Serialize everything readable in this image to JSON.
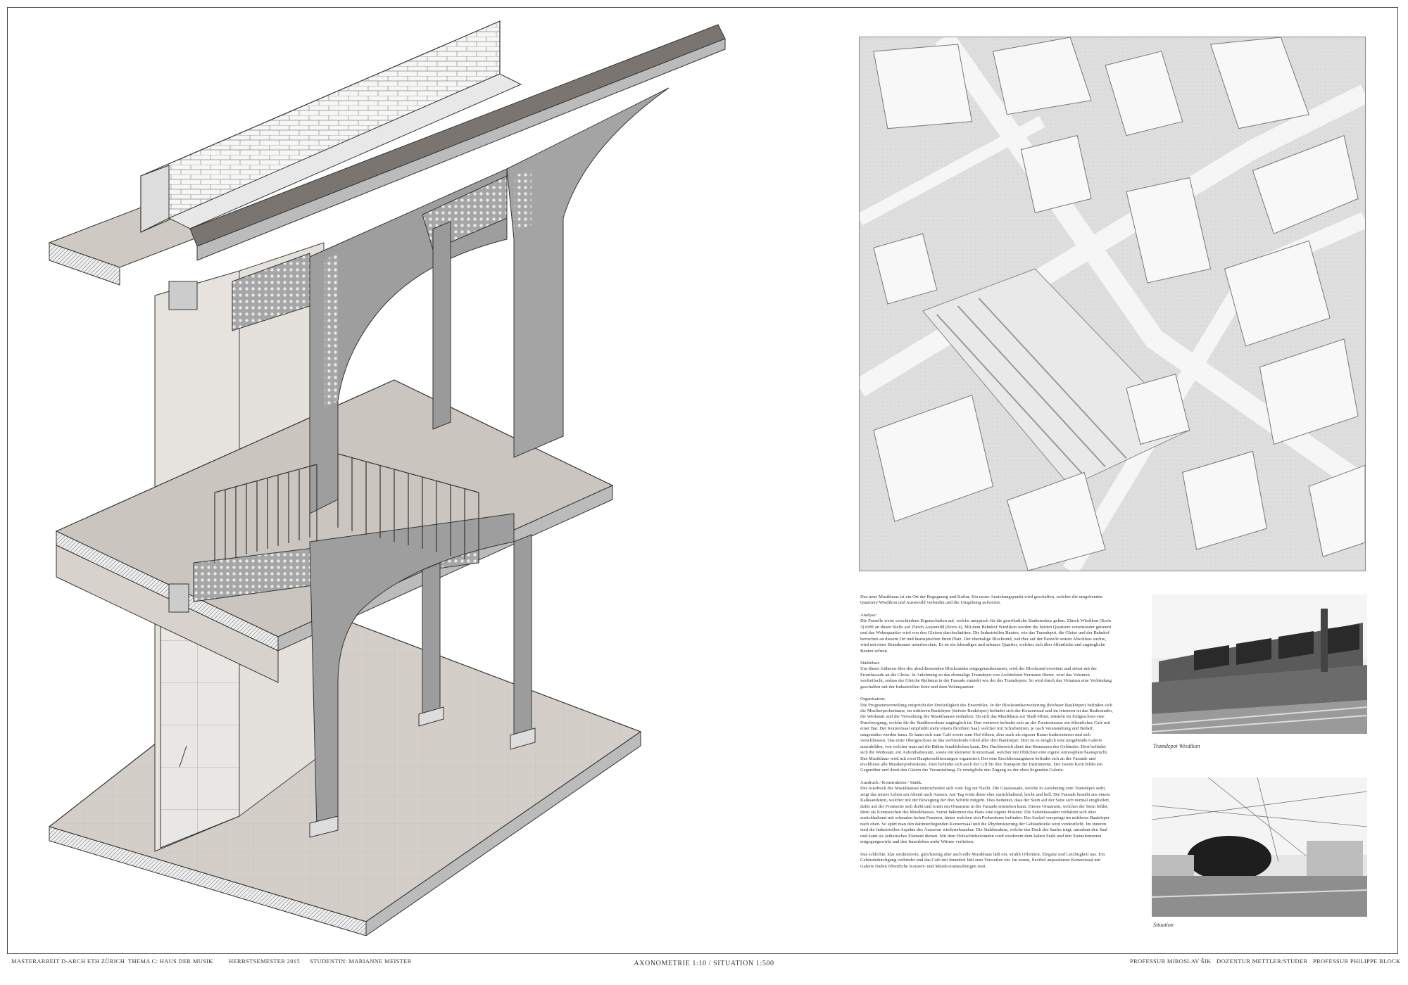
{
  "footer": {
    "left": [
      "MASTERARBEIT D-ARCH ETH ZÜRICH",
      "THEMA C: HAUS DER MUSIK",
      "HERBSTSEMESTER 2015",
      "STUDENTIN: MARIANNE MEISTER"
    ],
    "center": "AXONOMETRIE 1:10 / SITUATION 1:500",
    "right": [
      "PROFESSUR MIROSLAV ŠIK",
      "DOZENTUR METTLER/STUDER",
      "PROFESSUR PHILIPPE BLOCK"
    ]
  },
  "text": {
    "intro": "Das neue Musikhaus ist ein Ort der Begegnung und Kultur. Ein neuer Anziehungspunkt wird geschaffen, welcher die umgebenden Quartiere Wiedikon und Aussersihl verbindet und die Umgebung aufwertet.",
    "analyse_title": "Analyse:",
    "analyse": "Die Parzelle weist verschiedene Eigenschaften auf, welche untypisch für die gewöhnliche Stadtstruktur gelten. Zürich Wiedikon (Kreis 3) trifft an dieser Stelle auf Zürich Aussersihl (Kreis 4). Mit dem Bahnhof Wiedikon werden die beiden Quartiere voneinander getrennt und das Wohnquartier wird von den Gleisen durchschnitten. Die Industriellen Bauten, wie das Tramdepot, die Gleise und der Bahnhof herrschen an diesem Ort und beanspruchen ihren Platz. Der ehemalige Blockrand, welcher auf der Parzelle seinen Abschluss suchte, wird mit einer Brandmauer unterbrochen. Es ist ein lebendiges und urbanes Quartier, welches sich über öffentliche und zugängliche Bauten erfreut.",
    "staedtebau_title": "Städtebau:",
    "staedtebau": "Um dieser früheren Idee des abschliessenden Blockrandes entgegenzukommen, wird der Blockrand erweitert und stösst mit der Frontfassade an die Gleise. In Anlehnung an das ehemalige Tramdepot von Architekten Hermann Herter, wird das Volumen verdreifacht, sodass der Gleiche Rythmus in der Fassade entsteht wie der des Tramdepots. So wird durch das Volumen eine Verbindung geschaffen mit der Industriellen Seite und dem Wohnquartier.",
    "organisation_title": "Organisation:",
    "organisation": "Die Programmverteilung entspricht der Dreiteiligkeit des Ensembles. In der Blockrandserweiterung (höchster Baukörper) befinden sich die Musikerproberäume, im mittleren Baukörper (tiefster Baukörper) befindet sich der Konzertsaal und im letzteren ist das Radiostudio, die Werkstatt und die Verwaltung des Musikhauses enthalten. Da sich das Musikhaus zur Stadt öffnet, entsteht im Erdgeschoss eine Durchwegung, welche für die Stadtbewohner zugänglich ist. Den weiteren befindet sich an der Zweierstrasse ein öffentliches Café mit einer Bar. Der Konzertsaal empfiehlt mehr einem flexiblen Saal, welcher mit Schiebetüren, je nach Veranstaltung und Bedarf, umgestaltet werden kann. Er kann sich zum Café sowie zum Hof öffnen, aber auch als eigener Raum funktionieren und sich verschliessen. Das erste Obergeschoss ist das verbindende Glied aller drei Baukörper. Dort ist es möglich eine umgebende Galerie auszubilden, von welcher man auf die Bühne hinabblicken kann. Der Dachbereich dient den Benutzern des Gebäudes. Dort befindet sich die Werkstatt, ein Aufenthaltsraum, sowie ein kleinerer Konzertsaal, welcher mit Oblichter eine eigene Atmosphäre beansprucht. Das Musikhaus wird mit zwei Haupterschliessungen organisiert. Der eine Erschliessungskern befindet sich an der Fassade und erschliesst alle Musikerproberäume. Dort befindet sich auch der Lift für den Transport der Instrumente. Der zweite Kern bildet ein Gegenüber und dient den Gästen der Veranstaltung. Er ermöglicht den Zugang zu der oben liegenden Galerie.",
    "ausdruck_title": "Ausdruck / Konstruktion / Statik:",
    "ausdruck": "Der Ausdruck des Musikhauses unterscheidet sich vom Tag zur Nacht. Die Glasfassade, welche in Anlehnung zum Tramdepot steht, zeigt das innere Leben am Abend nach Aussen. Am Tag wirkt diese eher zurückhaltend, leicht und hell. Die Fassade besteht aus einem Kalksandstein, welcher mit der Bewegung der drei Schiffe mitgeht. Dies bedeutet, dass der Stein auf der Seite sich normal eingliedert, dafür auf der Frontseite sich dreht und somit ein Ornament in der Fassade entstehen kann. Dieses Ornament, welches der Stein bildet, dient als Kennzeichen des Musikhauses. Somit bekommt das Haus eine eigene Präsenz. Die Seitenfassaden verhalten sich eher zurückhaltend mit schmalen hohen Fenstern, hinter welchen sich Proberäume befinden. Der Sockel verspringt im mittleren Baukörper nach oben. So spürt man den dahinterliegenden Konzertsaal und die Rhythmisierung der Gebäudeteile wird verdeutlicht. Im Inneren sind die Industriellen Aspekte des Äusseren wiedererkennbar. Die Stahlstruktur, welche das Dach des Saales trägt, umrahmt den Saal und kann als ästhetisches Element dienen. Mit dem Holzschiebewänden wird wiederum dem kalten Stahl und den Steinelementen entgegengewirkt und den Innenleben mehr Wärme verliehen.",
    "closing": "Das schlichte, klar strukturierte, gleichzeitig aber auch edle Musikhaus lädt ein, strahlt Offenheit, Eleganz und Leichtigkeit aus. Ein Gebäudedurchgang verbindet und das Café mit Innenhof lädt zum Verweilen ein. Im neuen, flexibel anpassbaren Konzertsaal mit Galerie finden öffentliche Konzert- und Musikveranstaltungen statt."
  },
  "captions": {
    "photo1": "Tramdepot Wiedikon",
    "photo2": "Situation"
  },
  "colors": {
    "floor": "#cfc8c2",
    "concrete": "#9a9a9a",
    "wall": "#e2e0dc",
    "brick": "#f4f4f2",
    "ink": "#333333"
  }
}
